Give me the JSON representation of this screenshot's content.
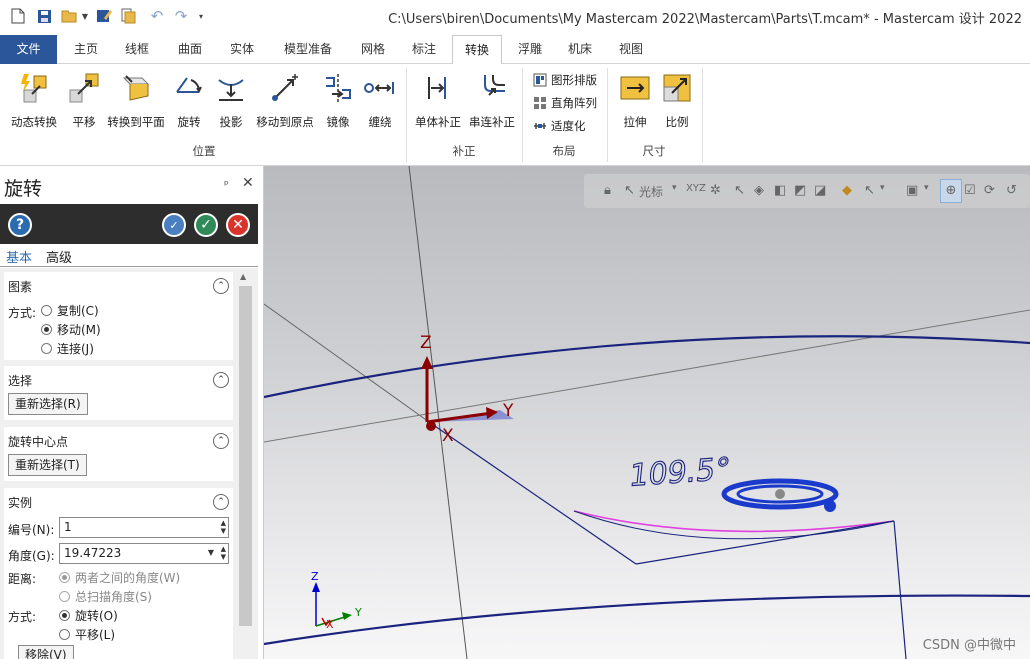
{
  "window": {
    "title": "C:\\Users\\biren\\Documents\\My Mastercam 2022\\Mastercam\\Parts\\T.mcam* - Mastercam 设计 2022"
  },
  "qat": {
    "icons": [
      "new-file-icon",
      "save-icon",
      "open-folder-icon",
      "dropdown-icon",
      "save-as-icon",
      "folder-icon",
      "undo-icon",
      "redo-icon",
      "customize-icon"
    ]
  },
  "tabs": [
    {
      "label": "文件"
    },
    {
      "label": "主页"
    },
    {
      "label": "线框"
    },
    {
      "label": "曲面"
    },
    {
      "label": "实体"
    },
    {
      "label": "模型准备"
    },
    {
      "label": "网格"
    },
    {
      "label": "标注"
    },
    {
      "label": "转换"
    },
    {
      "label": "浮雕"
    },
    {
      "label": "机床"
    },
    {
      "label": "视图"
    }
  ],
  "active_tab": "转换",
  "ribbon": {
    "position": {
      "label": "位置",
      "buttons": [
        {
          "label": "动态转换",
          "icon": "dynamic-transform-icon"
        },
        {
          "label": "平移",
          "icon": "translate-icon"
        },
        {
          "label": "转换到平面",
          "icon": "transform-to-plane-icon"
        },
        {
          "label": "旋转",
          "icon": "rotate-icon"
        },
        {
          "label": "投影",
          "icon": "project-icon"
        },
        {
          "label": "移动到原点",
          "icon": "move-to-origin-icon"
        },
        {
          "label": "镜像",
          "icon": "mirror-icon"
        },
        {
          "label": "缠绕",
          "icon": "wrap-icon"
        }
      ]
    },
    "offset": {
      "label": "补正",
      "buttons": [
        {
          "label": "单体补正",
          "icon": "offset-single-icon"
        },
        {
          "label": "串连补正",
          "icon": "offset-chain-icon"
        }
      ]
    },
    "layout": {
      "label": "布局",
      "buttons": [
        {
          "label": "图形排版",
          "icon": "nesting-icon"
        },
        {
          "label": "直角阵列",
          "icon": "rect-array-icon"
        },
        {
          "label": "适度化",
          "icon": "fit-icon"
        }
      ]
    },
    "size": {
      "label": "尺寸",
      "buttons": [
        {
          "label": "拉伸",
          "icon": "stretch-icon"
        },
        {
          "label": "比例",
          "icon": "scale-icon"
        }
      ]
    }
  },
  "panel": {
    "title": "旋转",
    "pin_glyph": "ᵖ",
    "close_glyph": "✕",
    "tabs": [
      {
        "label": "基本"
      },
      {
        "label": "高级"
      }
    ],
    "sections": {
      "entities": {
        "title": "图素",
        "method_label": "方式:",
        "options": [
          {
            "label": "复制(C)",
            "checked": false
          },
          {
            "label": "移动(M)",
            "checked": true
          },
          {
            "label": "连接(J)",
            "checked": false
          }
        ]
      },
      "selection": {
        "title": "选择",
        "button": "重新选择(R)"
      },
      "center": {
        "title": "旋转中心点",
        "button": "重新选择(T)"
      },
      "instance": {
        "title": "实例",
        "number_label": "编号(N):",
        "number_value": "1",
        "angle_label": "角度(G):",
        "angle_value": "19.47223",
        "distance_label": "距离:",
        "distance_options": [
          {
            "label": "两者之间的角度(W)",
            "checked": true
          },
          {
            "label": "总扫描角度(S)",
            "checked": false
          }
        ],
        "method_label": "方式:",
        "method_options": [
          {
            "label": "旋转(O)",
            "checked": true
          },
          {
            "label": "平移(L)",
            "checked": false
          }
        ],
        "remove_button": "移除(V)"
      }
    }
  },
  "viewport": {
    "toolbar": {
      "cursor_label": "光标",
      "xyz_label": "XYZ"
    },
    "axis_labels": {
      "z": "Z",
      "y": "Y",
      "x": "X"
    },
    "triad_labels": {
      "z": "Z",
      "y": "Y",
      "x": "X"
    },
    "angle_text": "109.5°",
    "watermark": "CSDN @中微中"
  },
  "colors": {
    "accent": "#2b579a",
    "geometry": "#1a237e",
    "arc": "#e040e0",
    "gnomon_z": "#8b0000",
    "gnomon_y": "#8b0000",
    "arrow_fill": "#7b7fd0",
    "triad_x": "#c00000",
    "triad_y": "#008000",
    "triad_z": "#0000cc"
  }
}
